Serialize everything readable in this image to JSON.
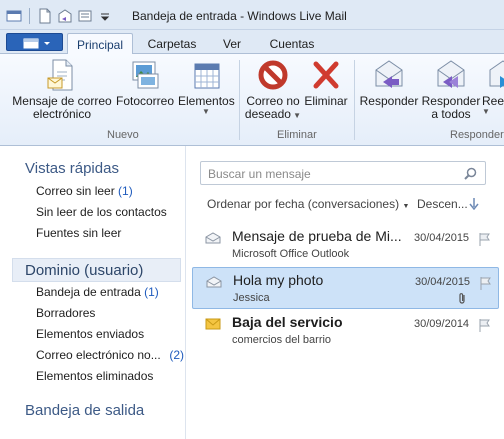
{
  "window": {
    "title": "Bandeja de entrada - Windows Live Mail"
  },
  "tabs": [
    "Principal",
    "Carpetas",
    "Ver",
    "Cuentas"
  ],
  "ribbon": {
    "nuevo": {
      "label": "Nuevo",
      "mensaje": [
        "Mensaje de correo",
        "electrónico"
      ],
      "fotocorreo": "Fotocorreo",
      "elementos": "Elementos"
    },
    "eliminar": {
      "label": "Eliminar",
      "correo_no_deseado": [
        "Correo no",
        "deseado"
      ],
      "eliminar": "Eliminar"
    },
    "responder": {
      "label": "Responder",
      "responder": "Responder",
      "responder_todos": [
        "Responder",
        "a todos"
      ],
      "reenviar": "Reen"
    }
  },
  "sidebar": {
    "quick_views_title": "Vistas rápidas",
    "quick_views": [
      {
        "label": "Correo sin leer",
        "count": "(1)"
      },
      {
        "label": "Sin leer de los contactos",
        "count": ""
      },
      {
        "label": "Fuentes sin leer",
        "count": ""
      }
    ],
    "account_title": "Dominio (usuario)",
    "folders": [
      {
        "label": "Bandeja de entrada",
        "count": "(1)"
      },
      {
        "label": "Borradores",
        "count": ""
      },
      {
        "label": "Elementos enviados",
        "count": ""
      },
      {
        "label": "Correo electrónico no...",
        "count": "(2)"
      },
      {
        "label": "Elementos eliminados",
        "count": ""
      }
    ],
    "outbox_title": "Bandeja de salida"
  },
  "message_list": {
    "search_placeholder": "Buscar un mensaje",
    "sort_label": "Ordenar por fecha (conversaciones)",
    "sort_direction": "Descen...",
    "messages": [
      {
        "subject": "Mensaje de prueba de Mi...",
        "from": "Microsoft Office Outlook",
        "date": "30/04/2015",
        "unread": false,
        "attachment": false,
        "selected": false
      },
      {
        "subject": "Hola my photo",
        "from": "Jessica",
        "date": "30/04/2015",
        "unread": false,
        "attachment": true,
        "selected": true
      },
      {
        "subject": "Baja del servicio",
        "from": "comercios del barrio",
        "date": "30/09/2014",
        "unread": true,
        "attachment": false,
        "selected": false
      }
    ]
  },
  "colors": {
    "accent": "#2a64b8",
    "selection": "#cde2f8",
    "link_count": "#1f5bbd"
  }
}
